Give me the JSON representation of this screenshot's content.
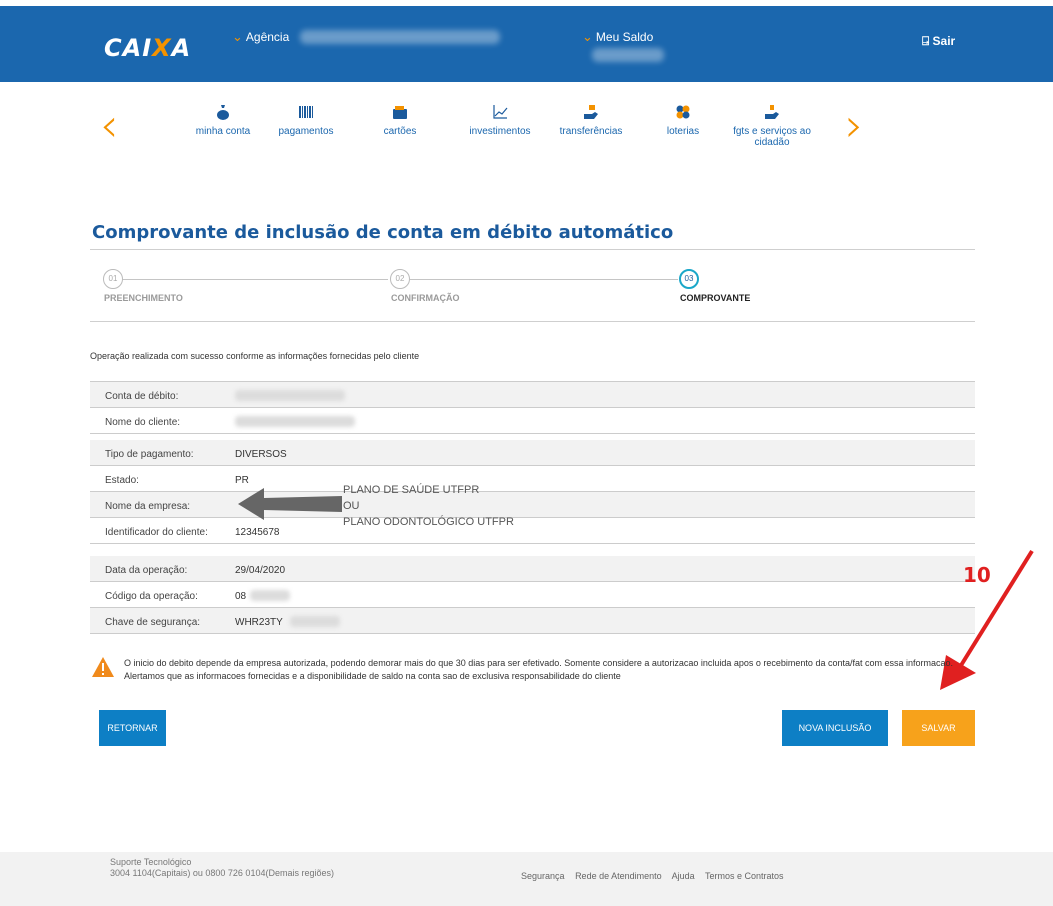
{
  "header": {
    "logo": "CAIXA",
    "agencia_label": "Agência",
    "saldo_label": "Meu Saldo",
    "sair_label": "Sair"
  },
  "nav": {
    "items": [
      {
        "label": "minha conta",
        "icon": "money-bag-icon"
      },
      {
        "label": "pagamentos",
        "icon": "barcode-icon"
      },
      {
        "label": "cartões",
        "icon": "wallet-icon"
      },
      {
        "label": "investimentos",
        "icon": "line-chart-icon"
      },
      {
        "label": "transferências",
        "icon": "transfer-hand-icon"
      },
      {
        "label": "loterias",
        "icon": "clover-icon"
      },
      {
        "label": "fgts e serviços ao cidadão",
        "icon": "hand-service-icon"
      }
    ]
  },
  "page": {
    "title": "Comprovante de inclusão de conta em débito automático"
  },
  "steps": [
    {
      "num": "01",
      "label": "PREENCHIMENTO"
    },
    {
      "num": "02",
      "label": "CONFIRMAÇÃO"
    },
    {
      "num": "03",
      "label": "COMPROVANTE"
    }
  ],
  "success_message": "Operação realizada com sucesso conforme as informações fornecidas pelo cliente",
  "details": {
    "conta_debito": "Conta de débito:",
    "nome_cliente": "Nome do cliente:",
    "tipo_pagamento_label": "Tipo de pagamento:",
    "tipo_pagamento_value": "DIVERSOS",
    "estado_label": "Estado:",
    "estado_value": "PR",
    "nome_empresa_label": "Nome da empresa:",
    "identificador_label": "Identificador do cliente:",
    "identificador_value": "12345678",
    "data_label": "Data da operação:",
    "data_value": "29/04/2020",
    "codigo_label": "Código da operação:",
    "codigo_value": "08",
    "chave_label": "Chave de segurança:",
    "chave_value": "WHR23TY"
  },
  "annotation": {
    "line1": "PLANO DE SAÚDE UTFPR",
    "line2": "OU",
    "line3": "PLANO ODONTOLÓGICO UTFPR",
    "step_number": "10"
  },
  "warning": {
    "text": "O inicio do debito depende da empresa autorizada, podendo demorar mais do que 30 dias para ser efetivado. Somente considere a autorizacao incluida apos o recebimento da conta/fat com essa informacao. Alertamos que as informacoes fornecidas e a disponibilidade de saldo na conta sao de exclusiva responsabilidade do cliente"
  },
  "buttons": {
    "retornar": "RETORNAR",
    "nova_inclusao": "NOVA INCLUSÃO",
    "salvar": "SALVAR"
  },
  "footer": {
    "suporte_title": "Suporte Tecnológico",
    "suporte_phones": "3004 1104(Capitais) ou 0800 726 0104(Demais regiões)",
    "links": [
      "Segurança",
      "Rede de Atendimento",
      "Ajuda",
      "Termos e Contratos"
    ]
  },
  "colors": {
    "brand_blue": "#1b67ae",
    "brand_orange": "#f39200",
    "button_blue": "#0d7fc5",
    "button_orange": "#f7a21b",
    "annotation_red": "#e02020"
  }
}
